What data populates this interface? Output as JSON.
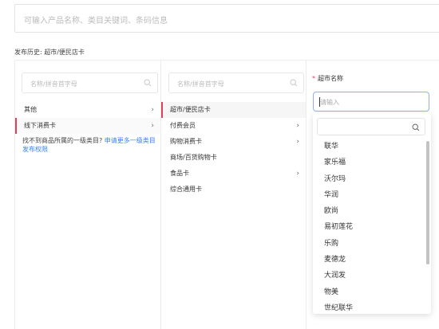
{
  "top_search": {
    "placeholder": "可输入产品名称、类目关键词、条码信息"
  },
  "history": {
    "label": "发布历史: 超市/便民店卡"
  },
  "col1": {
    "search_placeholder": "名称/拼音首字母",
    "items": [
      {
        "label": "其他",
        "has_children": true,
        "selected": false
      },
      {
        "label": "线下消费卡",
        "has_children": true,
        "selected": true
      }
    ],
    "note_text": "找不到商品所属的一级类目? ",
    "note_link": "申请更多一级类目发布权限"
  },
  "col2": {
    "search_placeholder": "名称/拼音首字母",
    "items": [
      {
        "label": "超市/便民店卡",
        "has_children": false,
        "selected": true
      },
      {
        "label": "付费会员",
        "has_children": true,
        "selected": false
      },
      {
        "label": "购物消费卡",
        "has_children": true,
        "selected": false
      },
      {
        "label": "商场/百货购物卡",
        "has_children": false,
        "selected": false
      },
      {
        "label": "食品卡",
        "has_children": true,
        "selected": false
      },
      {
        "label": "综合通用卡",
        "has_children": false,
        "selected": false
      }
    ]
  },
  "col3": {
    "required_mark": "*",
    "field_label": "超市名称",
    "select_placeholder": "请输入",
    "dropdown_options": [
      "联华",
      "家乐福",
      "沃尔玛",
      "华润",
      "欧尚",
      "易初莲花",
      "乐购",
      "麦德龙",
      "大润发",
      "物美",
      "世纪联华"
    ]
  },
  "colors": {
    "accent": "#e0405a",
    "link": "#3b82f6",
    "focus_border": "#8fb0ee"
  },
  "icons": {
    "search": "search-icon",
    "chevron": "chevron-right-icon"
  }
}
